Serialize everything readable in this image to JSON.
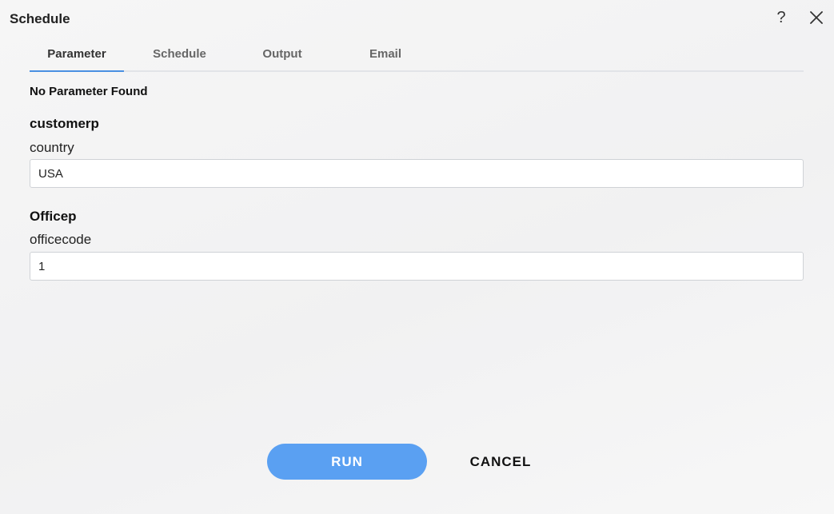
{
  "dialog": {
    "title": "Schedule",
    "help_glyph": "?",
    "icons": {
      "help": "help-icon",
      "close": "close-icon"
    }
  },
  "tabs": [
    {
      "label": "Parameter",
      "active": true
    },
    {
      "label": "Schedule",
      "active": false
    },
    {
      "label": "Output",
      "active": false
    },
    {
      "label": "Email",
      "active": false
    }
  ],
  "parameter": {
    "empty_message": "No Parameter Found",
    "groups": [
      {
        "title": "customerp",
        "field_label": "country",
        "value": "USA"
      },
      {
        "title": "Officep",
        "field_label": "officecode",
        "value": "1"
      }
    ]
  },
  "actions": {
    "run_label": "RUN",
    "cancel_label": "CANCEL"
  },
  "colors": {
    "accent": "#5aa0f2",
    "tab_indicator": "#4a90e2"
  }
}
